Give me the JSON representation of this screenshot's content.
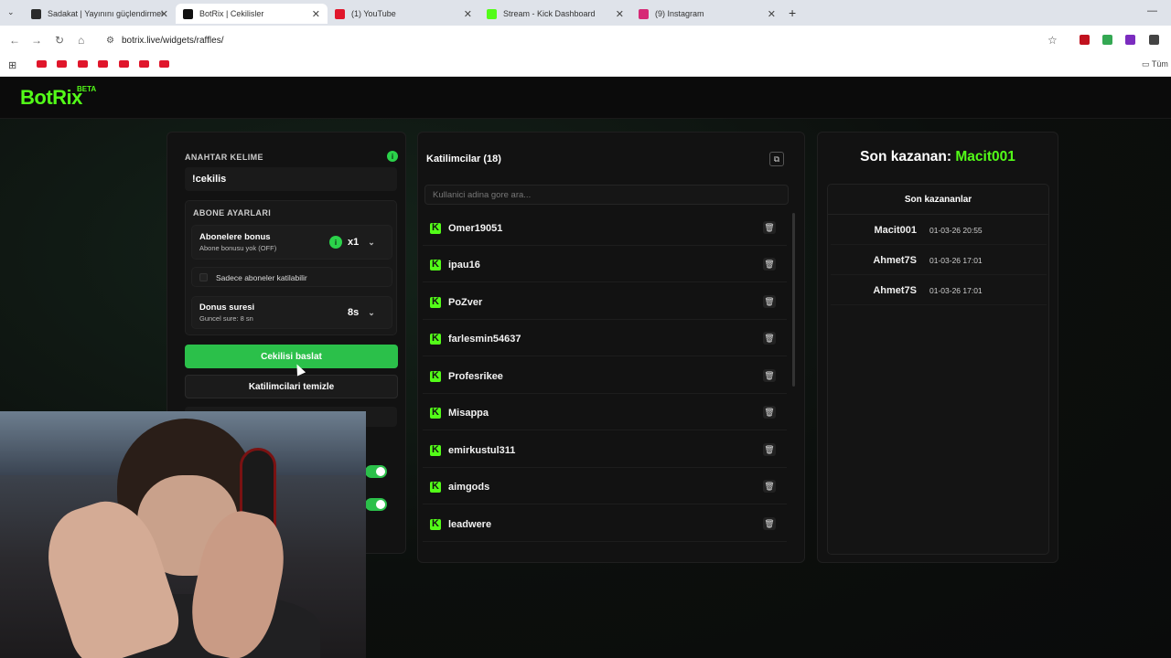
{
  "browser": {
    "tabs": [
      {
        "title": "Sadakat | Yayınını güçlendirmei",
        "color": "#2b2b2b"
      },
      {
        "title": "BotRix | Cekilisler",
        "color": "#111111"
      },
      {
        "title": "(1) YouTube",
        "color": "#e0162b"
      },
      {
        "title": "Stream - Kick Dashboard",
        "color": "#53fc18"
      },
      {
        "title": "(9) Instagram",
        "color": "#d62976"
      }
    ],
    "url": "botrix.live/widgets/raffles/",
    "bookmarks_folder": "Tüm"
  },
  "app": {
    "logo": "BotRix",
    "beta": "BETA"
  },
  "settings": {
    "keyword_label": "ANAHTAR KELIME",
    "keyword_value": "!cekilis",
    "sub_section_label": "ABONE AYARLARI",
    "sub_bonus_label": "Abonelere bonus",
    "sub_bonus_sub": "Abone bonusu yok (OFF)",
    "sub_bonus_value": "x1",
    "only_subs_label": "Sadece aboneler katilabilir",
    "bonus_time_label": "Donus suresi",
    "bonus_time_sub": "Guncel sure: 8 sn",
    "bonus_time_value": "8s",
    "start_button": "Cekilisi baslat",
    "clear_button": "Katilimcilari temizle"
  },
  "participants": {
    "title": "Katilimcilar (18)",
    "search_placeholder": "Kullanici adina gore ara...",
    "list": [
      "Omer19051",
      "ipau16",
      "PoZver",
      "farlesmin54637",
      "Profesrikee",
      "Misappa",
      "emirkustul311",
      "aimgods",
      "leadwere"
    ]
  },
  "winners": {
    "last_winner_label": "Son kazanan:",
    "last_winner_name": "Macit001",
    "list_title": "Son kazananlar",
    "list": [
      {
        "name": "Macit001",
        "date": "01-03-26 20:55"
      },
      {
        "name": "Ahmet7S",
        "date": "01-03-26 17:01"
      },
      {
        "name": "Ahmet7S",
        "date": "01-03-26 17:01"
      }
    ]
  },
  "colors": {
    "accent": "#53fc18",
    "button_green": "#2bc04a"
  }
}
